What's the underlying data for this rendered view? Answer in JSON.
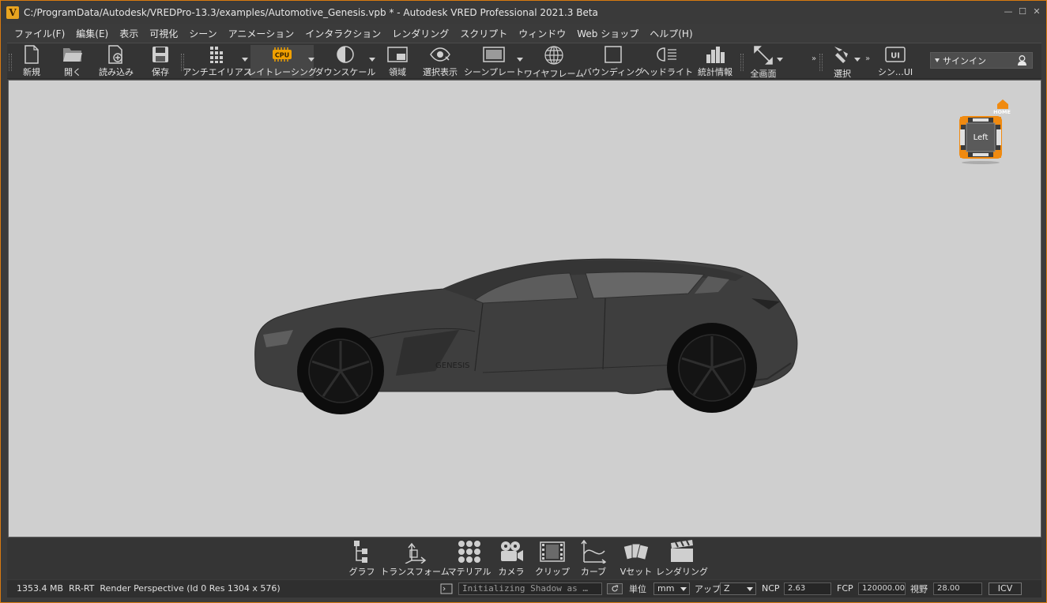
{
  "window": {
    "title": "C:/ProgramData/Autodesk/VREDPro-13.3/examples/Automotive_Genesis.vpb * - Autodesk VRED Professional 2021.3 Beta",
    "logo_letter": "V",
    "minimize": "—",
    "maximize": "☐",
    "close": "✕"
  },
  "menu": [
    "ファイル(F)",
    "編集(E)",
    "表示",
    "可視化",
    "シーン",
    "アニメーション",
    "インタラクション",
    "レンダリング",
    "スクリプト",
    "ウィンドウ",
    "Web ショップ",
    "ヘルプ(H)"
  ],
  "toolbar": {
    "new": "新規",
    "open": "開く",
    "import": "読み込み",
    "save": "保存",
    "antialias": "アンチエイリアス",
    "raytracing": "レイトレーシング",
    "raytracing_badge": "CPU",
    "downscale": "ダウンスケール",
    "region": "領域",
    "show_selected": "選択表示",
    "scene_plate": "シーンプレート",
    "wireframe": "ワイヤフレーム",
    "bounding": "バウンディング",
    "headlight": "ヘッドライト",
    "statistics": "統計情報",
    "fullscreen": "全画面",
    "select": "選択",
    "scene_ui": "シン…UI",
    "scene_ui_badge": "UI",
    "signin": "サインイン"
  },
  "navcube": {
    "face": "Left",
    "home": "HOME"
  },
  "car": {
    "badge": "GENESIS"
  },
  "modules": {
    "graph": "グラフ",
    "transform": "トランスフォーム",
    "material": "マテリアル",
    "camera": "カメラ",
    "clip": "クリップ",
    "curve": "カーブ",
    "vset": "Vセット",
    "rendering": "レンダリング"
  },
  "status": {
    "memory": "1353.4 MB",
    "mode": "RR-RT",
    "render_info": "Render Perspective (Id 0 Res 1304 x 576)",
    "message": "Initializing Shadow as …",
    "unit_label": "単位",
    "unit_value": "mm",
    "up_label": "アップ",
    "up_value": "Z",
    "ncp_label": "NCP",
    "ncp_value": "2.63",
    "fcp_label": "FCP",
    "fcp_value": "120000.00",
    "fov_label": "視野",
    "fov_value": "28.00",
    "icv": "ICV"
  }
}
